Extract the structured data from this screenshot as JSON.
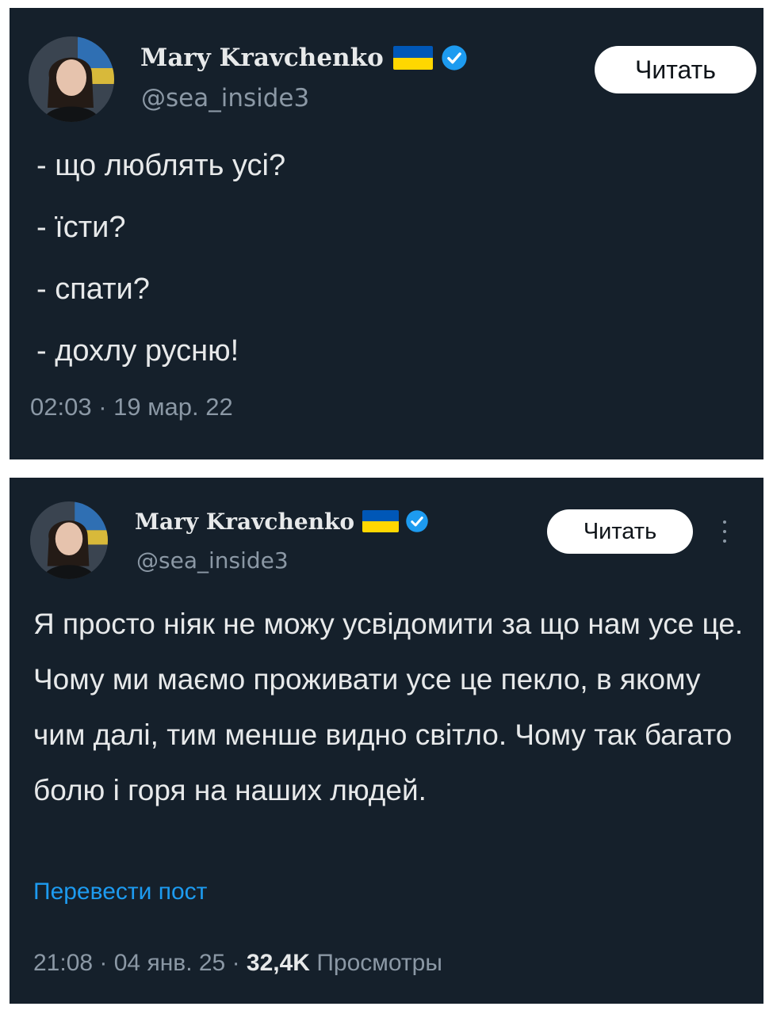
{
  "posts": [
    {
      "author": {
        "name": "Mary Kravchenko",
        "handle": "@sea_inside3"
      },
      "follow_label": "Читать",
      "lines": [
        "- що люблять усі?",
        "- їсти?",
        "- спати?",
        "- дохлу русню!"
      ],
      "time": "02:03",
      "date": "19 мар. 22"
    },
    {
      "author": {
        "name": "Mary Kravchenko",
        "handle": "@sea_inside3"
      },
      "follow_label": "Читать",
      "text": "Я просто ніяк не можу усвідомити за що нам усе це. Чому ми маємо проживати усе це пекло, в якому чим далі, тим менше видно світло. Чому так багато болю і горя на наших людей.",
      "translate_label": "Перевести пост",
      "time": "21:08",
      "date": "04 янв. 25",
      "views_count": "32,4K",
      "views_label": "Просмотры"
    }
  ],
  "separator": " · ",
  "colors": {
    "background": "#15202b",
    "text": "#e7e9ea",
    "muted": "#8b98a5",
    "link": "#1d9bf0",
    "verified": "#1d9bf0",
    "flag_blue": "#0057b7",
    "flag_yellow": "#ffd700",
    "button_bg": "#ffffff"
  },
  "icons": [
    "avatar",
    "ukraine-flag-icon",
    "verified-badge-icon",
    "more-options-icon"
  ]
}
